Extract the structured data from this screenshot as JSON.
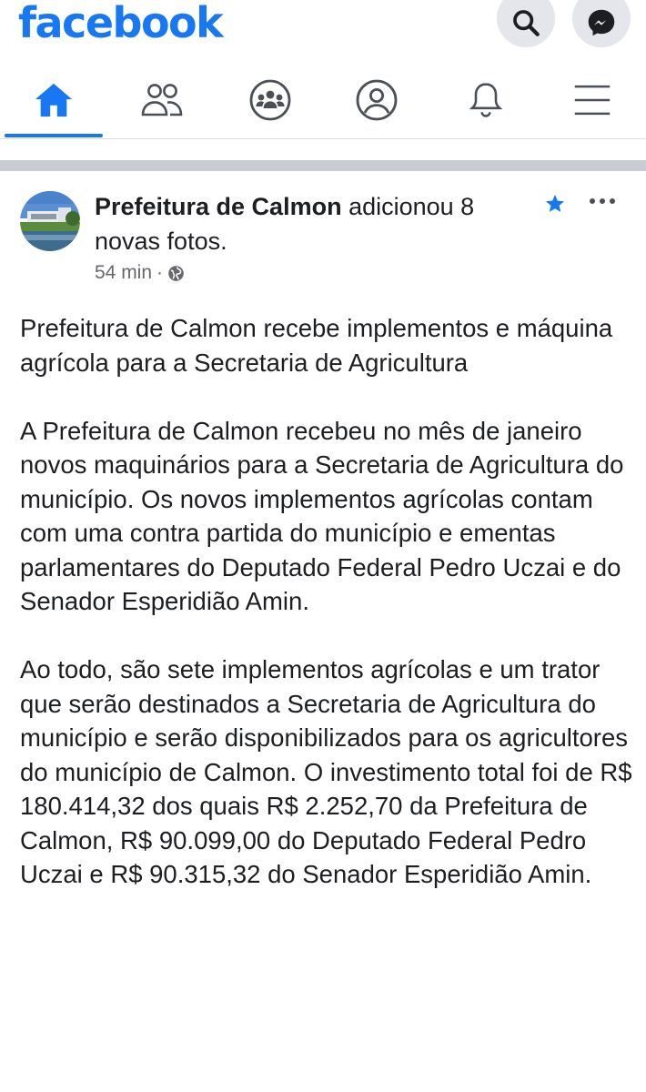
{
  "app": {
    "logo_text": "facebook"
  },
  "topbar": {
    "buttons": [
      {
        "icon": "search-icon"
      },
      {
        "icon": "messenger-icon"
      }
    ]
  },
  "nav": {
    "items": [
      {
        "icon": "home-icon",
        "active": true
      },
      {
        "icon": "friends-icon"
      },
      {
        "icon": "groups-icon"
      },
      {
        "icon": "profile-icon"
      },
      {
        "icon": "bell-icon"
      },
      {
        "icon": "menu-icon"
      }
    ],
    "accent_color": "#1877f2"
  },
  "post": {
    "author": "Prefeitura de Calmon",
    "action": " adicionou 8 novas fotos.",
    "time": "54 min",
    "separator": "·",
    "privacy_icon": "globe-icon",
    "favorite_icon": "star-icon",
    "more_icon": "more-dots-icon",
    "paragraphs": [
      "Prefeitura de Calmon recebe implementos e máquina agrícola para a Secretaria de Agricultura",
      "A Prefeitura de Calmon recebeu no mês de janeiro novos maquinários para a Secretaria de Agricultura do município. Os novos implementos agrícolas contam com uma contra partida do município e ementas parlamentares do Deputado Federal Pedro Uczai e do Senador Esperidião Amin.",
      "Ao todo, são sete implementos agrícolas e um trator que serão destinados a Secretaria de Agricultura do município e serão disponibilizados para os agricultores do município de Calmon. O investimento total foi de R$ 180.414,32 dos quais R$ 2.252,70 da Prefeitura de Calmon, R$ 90.099,00 do Deputado Federal Pedro Uczai e R$ 90.315,32 do Senador Esperidião Amin."
    ]
  }
}
